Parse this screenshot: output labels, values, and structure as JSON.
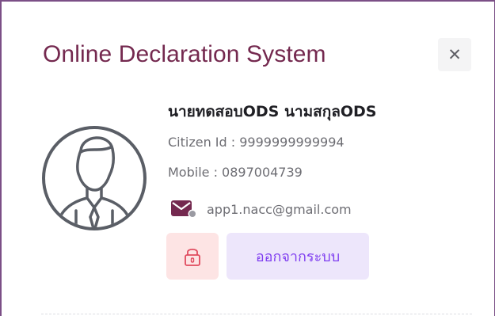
{
  "dialog": {
    "title": "Online Declaration System",
    "close_symbol": "✕"
  },
  "user": {
    "name": "นายทดสอบODS นามสกุลODS",
    "citizen_id": "Citizen Id : 9999999999994",
    "mobile": "Mobile : 0897004739",
    "email": "app1.nacc@gmail.com"
  },
  "actions": {
    "logout_label": "ออกจากระบบ"
  },
  "icons": {
    "avatar": "user-avatar-icon",
    "email": "email-icon",
    "lock": "lock-icon",
    "close": "close-icon"
  },
  "colors": {
    "title": "#74294f",
    "frame": "#7b4f86",
    "lock_button_bg": "#fde4e4",
    "lock_icon": "#e04b5e",
    "logout_button_bg": "#ede6fb",
    "logout_text": "#7f3ef0"
  }
}
